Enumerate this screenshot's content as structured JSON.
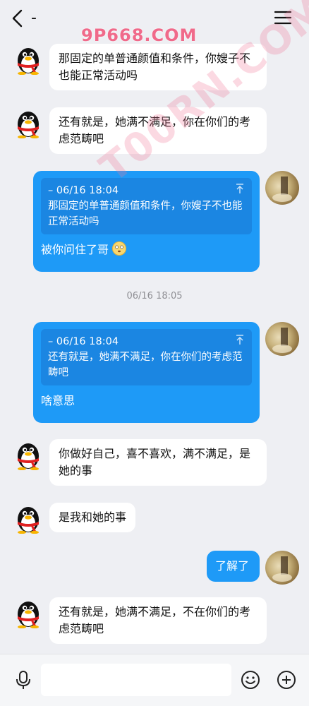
{
  "header": {
    "title": "-"
  },
  "watermarks": {
    "brand": "9P668.COM",
    "diagonal": "T00RN.COM"
  },
  "messages": {
    "m1": {
      "text": "那固定的单普通颜值和条件，你嫂子不也能正常活动吗"
    },
    "m2": {
      "text": "还有就是，她满不满足，你在你们的考虑范畴吧"
    },
    "m3": {
      "quote_time": "– 06/16 18:04",
      "quote_text": "那固定的单普通颜值和条件，你嫂子不也能正常活动吗",
      "reply": "被你问住了哥"
    },
    "timestamp": "06/16 18:05",
    "m4": {
      "quote_time": "– 06/16 18:04",
      "quote_text": "还有就是，她满不满足，你在你们的考虑范畴吧",
      "reply": "啥意思"
    },
    "m5": {
      "text": "你做好自己，喜不喜欢，满不满足，是她的事"
    },
    "m6": {
      "text": "是我和她的事"
    },
    "m7": {
      "text": "了解了"
    },
    "m8": {
      "text": "还有就是，她满不满足，不在你们的考虑范畴吧"
    }
  },
  "colors": {
    "bubble_blue": "#1e9af7",
    "quote_blue": "#1b86e2",
    "background": "#eeeff3"
  },
  "icons": [
    "back-arrow-icon",
    "menu-icon",
    "microphone-icon",
    "emoji-icon",
    "plus-icon",
    "qq-penguin-icon",
    "scroll-top-icon"
  ]
}
